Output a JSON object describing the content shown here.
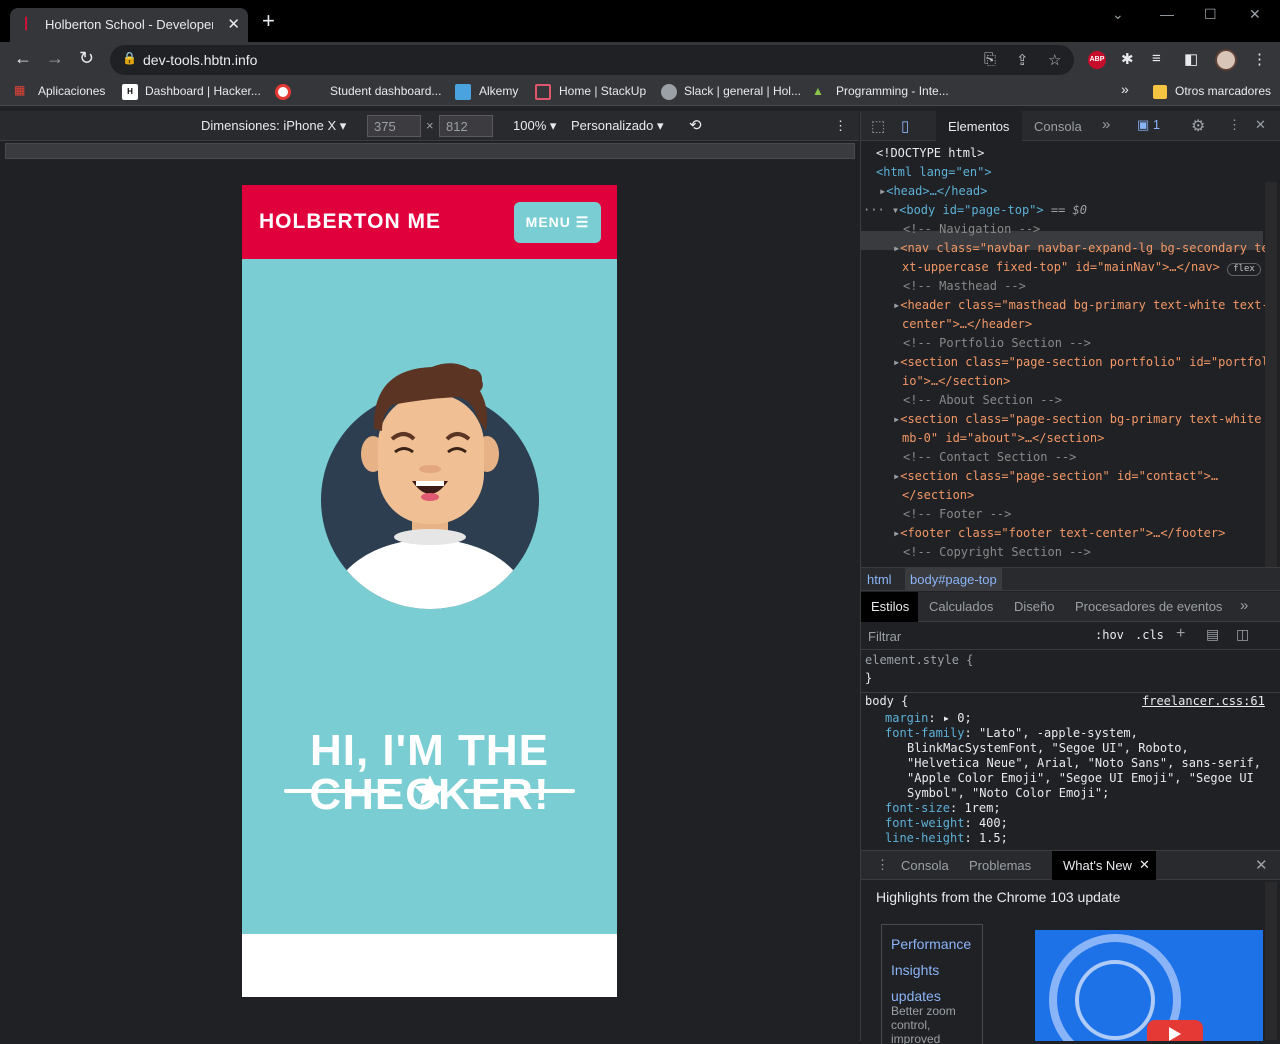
{
  "browser": {
    "tab_title": "Holberton School - Developer tools",
    "tab_favicon": "holberton-logo-icon",
    "url": "dev-tools.hbtn.info",
    "abp_label": "ABP"
  },
  "bookmarks": {
    "items": [
      {
        "label": "Aplicaciones",
        "icon": "apps-grid-icon"
      },
      {
        "label": "Dashboard | Hacker...",
        "icon": "hackerrank-icon"
      },
      {
        "label": "",
        "icon": "target-icon"
      },
      {
        "label": "Student dashboard...",
        "icon": "holberton-icon"
      },
      {
        "label": "Alkemy",
        "icon": "alkemy-icon"
      },
      {
        "label": "Home | StackUp",
        "icon": "stackup-icon"
      },
      {
        "label": "Slack | general | Hol...",
        "icon": "globe-icon"
      },
      {
        "label": "Programming - Inte...",
        "icon": "mountain-icon"
      }
    ],
    "overflow": "»",
    "other_label": "Otros marcadores"
  },
  "device_toolbar": {
    "device_label": "Dimensiones: iPhone X",
    "width": "375",
    "height": "812",
    "times": "×",
    "zoom": "100%",
    "throttle": "Personalizado"
  },
  "page": {
    "brand": "HOLBERTON ME",
    "menu_label": "MENU ☰",
    "hero_line1": "HI, I'M THE",
    "hero_line2": "CHECKER!",
    "colors": {
      "nav": "#e0003c",
      "masthead": "#7acdd3"
    }
  },
  "devtools": {
    "tabs": [
      "Elementos",
      "Consola"
    ],
    "issues_count": "1",
    "elements": {
      "doctype": "<!DOCTYPE html>",
      "html_open": "<html lang=\"en\">",
      "head": "<head>…</head>",
      "body": "<body id=\"page-top\">",
      "body_suffix": " == $0",
      "c_nav": "<!-- Navigation -->",
      "nav_l1": "<nav class=\"navbar navbar-expand-lg bg-secondary te",
      "nav_l2": "xt-uppercase fixed-top\" id=\"mainNav\">…</nav>",
      "flex_badge": "flex",
      "c_masthead": "<!-- Masthead -->",
      "header_l1": "<header class=\"masthead bg-primary text-white text-",
      "header_l2": "center\">…</header>",
      "c_portfolio": "<!-- Portfolio Section -->",
      "port_l1": "<section class=\"page-section portfolio\" id=\"portfol",
      "port_l2": "io\">…</section>",
      "c_about": "<!-- About Section -->",
      "about_l1": "<section class=\"page-section bg-primary text-white",
      "about_l2": "mb-0\" id=\"about\">…</section>",
      "c_contact": "<!-- Contact Section -->",
      "contact_l1": "<section class=\"page-section\" id=\"contact\">…",
      "contact_l2": "</section>",
      "c_footer": "<!-- Footer -->",
      "footer": "<footer class=\"footer text-center\">…</footer>",
      "c_copyright": "<!-- Copyright Section -->"
    },
    "breadcrumbs": [
      "html",
      "body#page-top"
    ],
    "subtabs": [
      "Estilos",
      "Calculados",
      "Diseño",
      "Procesadores de eventos"
    ],
    "filter_placeholder": "Filtrar",
    "hov": ":hov",
    "cls": ".cls",
    "styles": {
      "element_style": "element.style {",
      "close": "}",
      "body_selector": "body {",
      "source": "freelancer.css:61",
      "margin_prop": "margin",
      "margin_val": "0;",
      "ff_prop": "font-family",
      "ff_l1": "\"Lato\", -apple-system,",
      "ff_l2": "BlinkMacSystemFont, \"Segoe UI\", Roboto,",
      "ff_l3": "\"Helvetica Neue\", Arial, \"Noto Sans\", sans-serif,",
      "ff_l4": "\"Apple Color Emoji\", \"Segoe UI Emoji\", \"Segoe UI",
      "ff_l5": "Symbol\", \"Noto Color Emoji\";",
      "fs_prop": "font-size",
      "fs_val": "1rem;",
      "fw_prop": "font-weight",
      "fw_val": "400;",
      "lh_prop": "line-height",
      "lh_val": "1.5;"
    },
    "drawer_tabs": [
      "Consola",
      "Problemas",
      "What's New"
    ],
    "whats_new": {
      "headline": "Highlights from the Chrome 103 update",
      "card_link": "Performance Insights updates",
      "card_desc": "Better zoom control, improved"
    }
  }
}
